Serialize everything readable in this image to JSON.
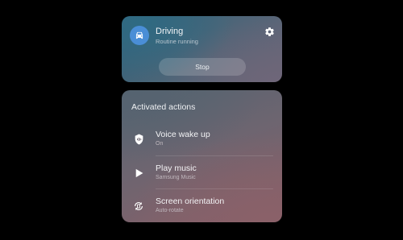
{
  "routine": {
    "title": "Driving",
    "status": "Routine running",
    "stop_label": "Stop",
    "icon": "car-icon",
    "settings_icon": "gear-icon"
  },
  "actions": {
    "heading": "Activated actions",
    "items": [
      {
        "title": "Voice wake up",
        "subtitle": "On",
        "icon": "voice-wake-icon"
      },
      {
        "title": "Play music",
        "subtitle": "Samsung Music",
        "icon": "play-icon"
      },
      {
        "title": "Screen orientation",
        "subtitle": "Auto-rotate",
        "icon": "rotate-icon"
      }
    ]
  },
  "colors": {
    "background": "#000000",
    "accent_blue": "#4a8ed6"
  }
}
